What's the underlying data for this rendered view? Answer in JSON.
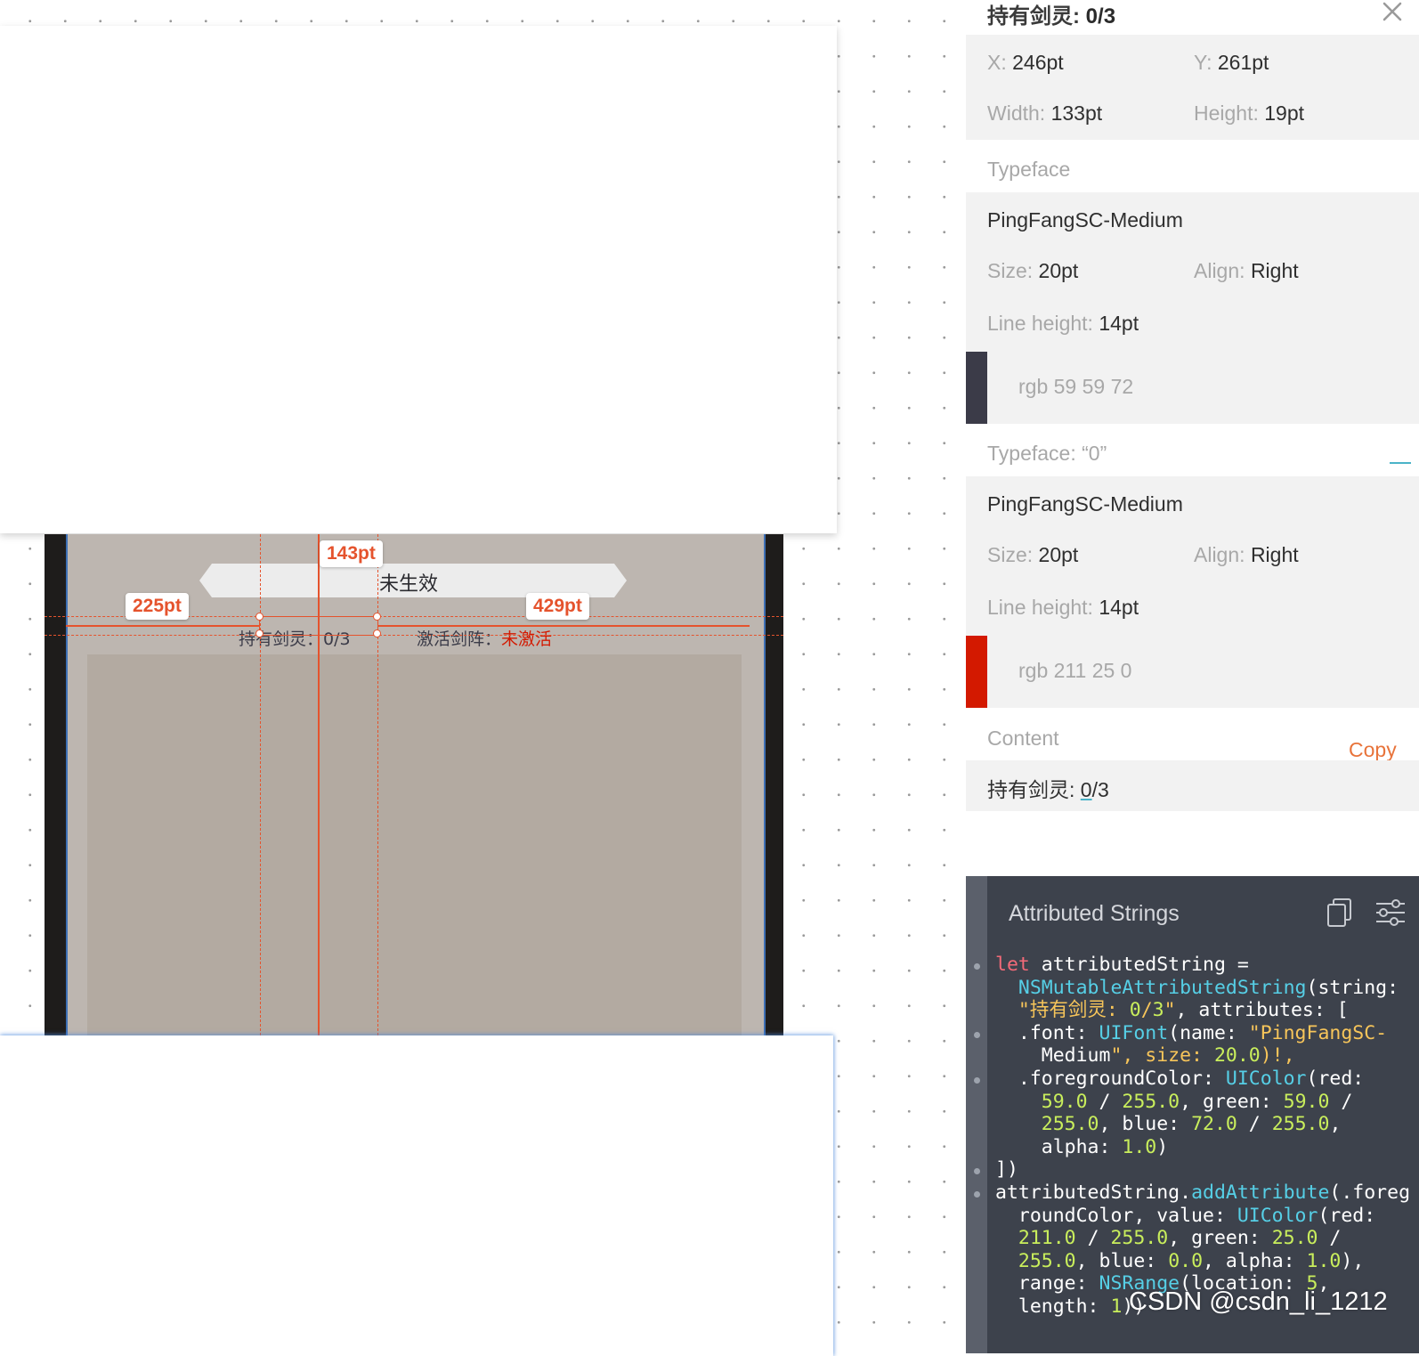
{
  "canvas": {
    "banner_text": "未生效",
    "stat_label": "持有剑灵：0/3",
    "stat2_prefix": "激活剑阵：",
    "stat2_value": "未激活",
    "measure_top": "143pt",
    "measure_left": "225pt",
    "measure_right": "429pt"
  },
  "inspector": {
    "title_prefix": "持有剑灵: ",
    "title_value": "0/3",
    "x_label": "X:",
    "x_value": "246pt",
    "y_label": "Y:",
    "y_value": "261pt",
    "width_label": "Width:",
    "width_value": "133pt",
    "height_label": "Height:",
    "height_value": "19pt",
    "typeface_header": "Typeface",
    "font1": {
      "name": "PingFangSC-Medium",
      "size_label": "Size:",
      "size_value": "20pt",
      "align_label": "Align:",
      "align_value": "Right",
      "lh_label": "Line height:",
      "lh_value": "14pt",
      "color_text": "rgb 59 59 72",
      "color_hex": "#3b3b48"
    },
    "typeface2_header": "Typeface: “0”",
    "font2": {
      "name": "PingFangSC-Medium",
      "size_label": "Size:",
      "size_value": "20pt",
      "align_label": "Align:",
      "align_value": "Right",
      "lh_label": "Line height:",
      "lh_value": "14pt",
      "color_text": "rgb 211 25 0",
      "color_hex": "#d31900"
    },
    "content_header": "Content",
    "copy_label": "Copy",
    "content_prefix": "持有剑灵: ",
    "content_underlined": "0",
    "content_suffix": "/3"
  },
  "code_panel": {
    "title": "Attributed Strings",
    "icons": [
      "copy-icon",
      "settings-sliders-icon"
    ],
    "lines": [
      "let attributedString =",
      "  NSMutableAttributedString(string:",
      "  \"持有剑灵: 0/3\", attributes: [",
      "  .font: UIFont(name: \"PingFangSC-",
      "    Medium\", size: 20.0)!,",
      "  .foregroundColor: UIColor(red:",
      "    59.0 / 255.0, green: 59.0 /",
      "    255.0, blue: 72.0 / 255.0,",
      "    alpha: 1.0)",
      "])",
      "attributedString.addAttribute(.foreg",
      "  roundColor, value: UIColor(red:",
      "  211.0 / 255.0, green: 25.0 /",
      "  255.0, blue: 0.0, alpha: 1.0),",
      "  range: NSRange(location: 5,",
      "  length: 1))"
    ]
  },
  "watermark": "CSDN @csdn_li_1212",
  "colors": {
    "accent": "#e5532d",
    "copy_link": "#e8733a",
    "code_bg": "#3d424c"
  }
}
